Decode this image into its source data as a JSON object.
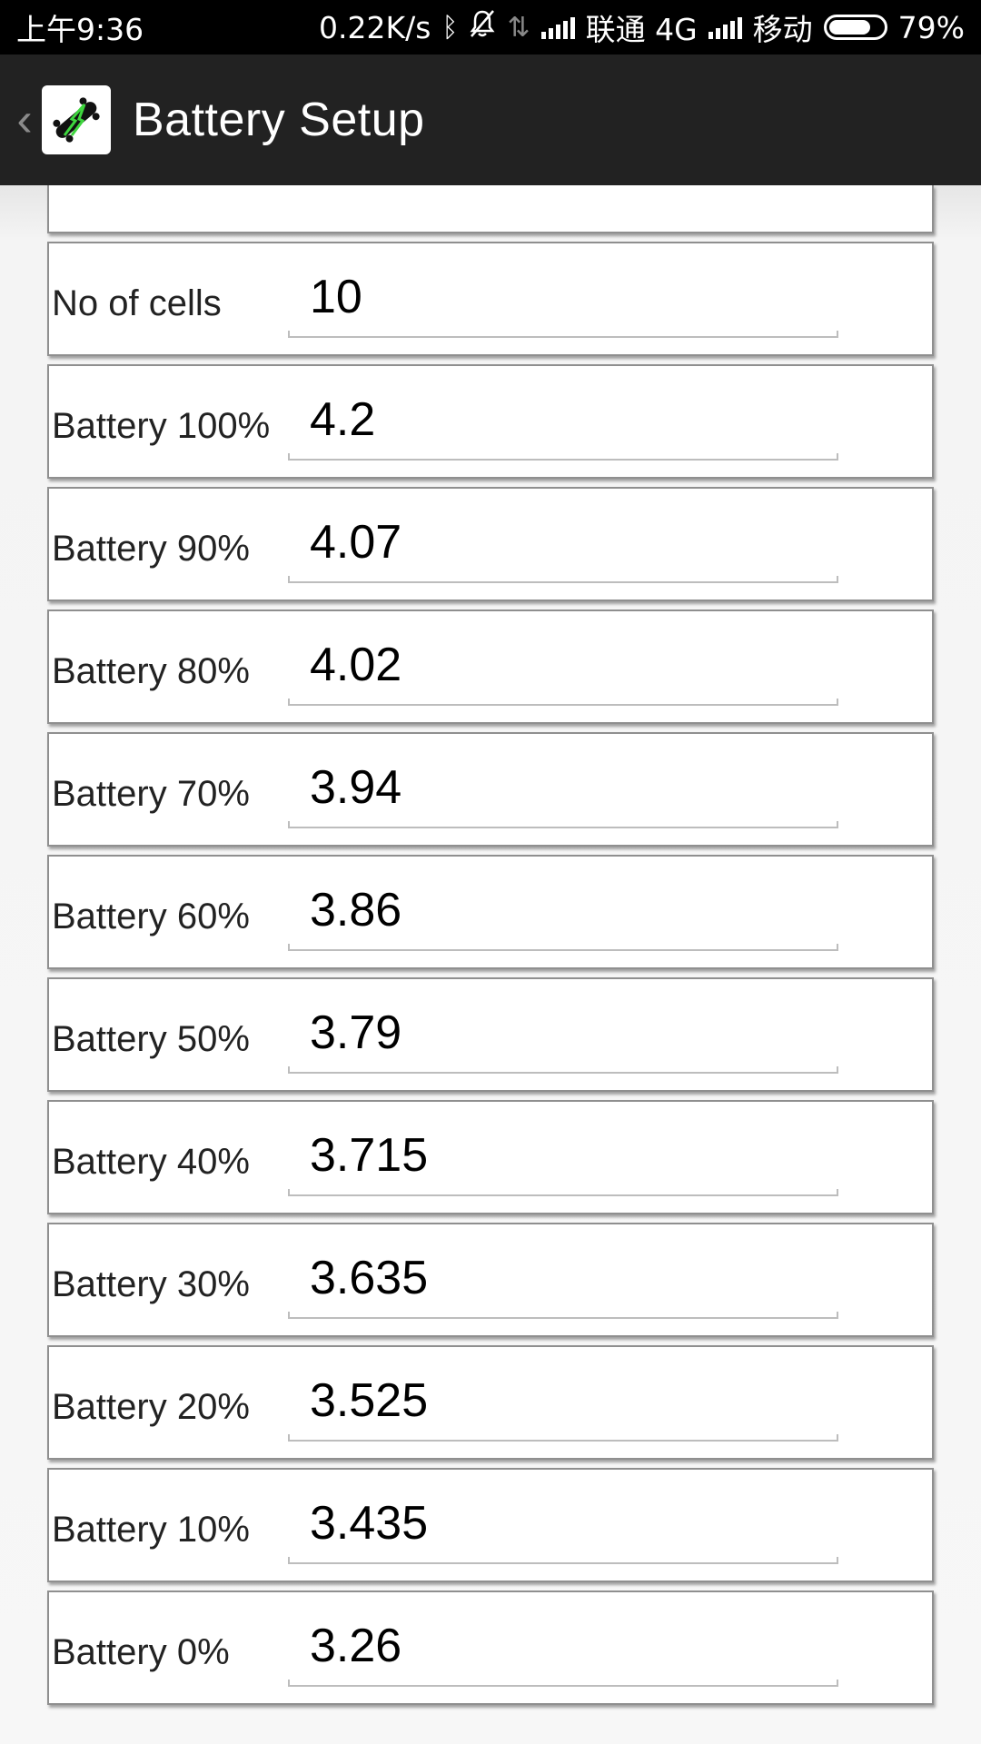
{
  "status_bar": {
    "time": "上午9:36",
    "net_speed": "0.22K/s",
    "carrier1": "联通 4G",
    "carrier2": "移动",
    "battery_percent": "79%",
    "battery_level": 0.79,
    "icons": [
      "bluetooth-icon",
      "bell-off-icon",
      "data-transfer-icon",
      "signal-icon",
      "battery-icon"
    ]
  },
  "app_bar": {
    "title": "Battery Setup",
    "logo_icon": "skateboard-bolt-icon",
    "accent_color": "#3ed63e"
  },
  "settings": [
    {
      "label": "No of cells",
      "value": "10"
    },
    {
      "label": "Battery 100%",
      "value": "4.2"
    },
    {
      "label": "Battery 90%",
      "value": "4.07"
    },
    {
      "label": "Battery 80%",
      "value": "4.02"
    },
    {
      "label": "Battery 70%",
      "value": "3.94"
    },
    {
      "label": "Battery 60%",
      "value": "3.86"
    },
    {
      "label": "Battery 50%",
      "value": "3.79"
    },
    {
      "label": "Battery 40%",
      "value": "3.715"
    },
    {
      "label": "Battery 30%",
      "value": "3.635"
    },
    {
      "label": "Battery 20%",
      "value": "3.525"
    },
    {
      "label": "Battery 10%",
      "value": "3.435"
    },
    {
      "label": "Battery 0%",
      "value": "3.26"
    }
  ]
}
